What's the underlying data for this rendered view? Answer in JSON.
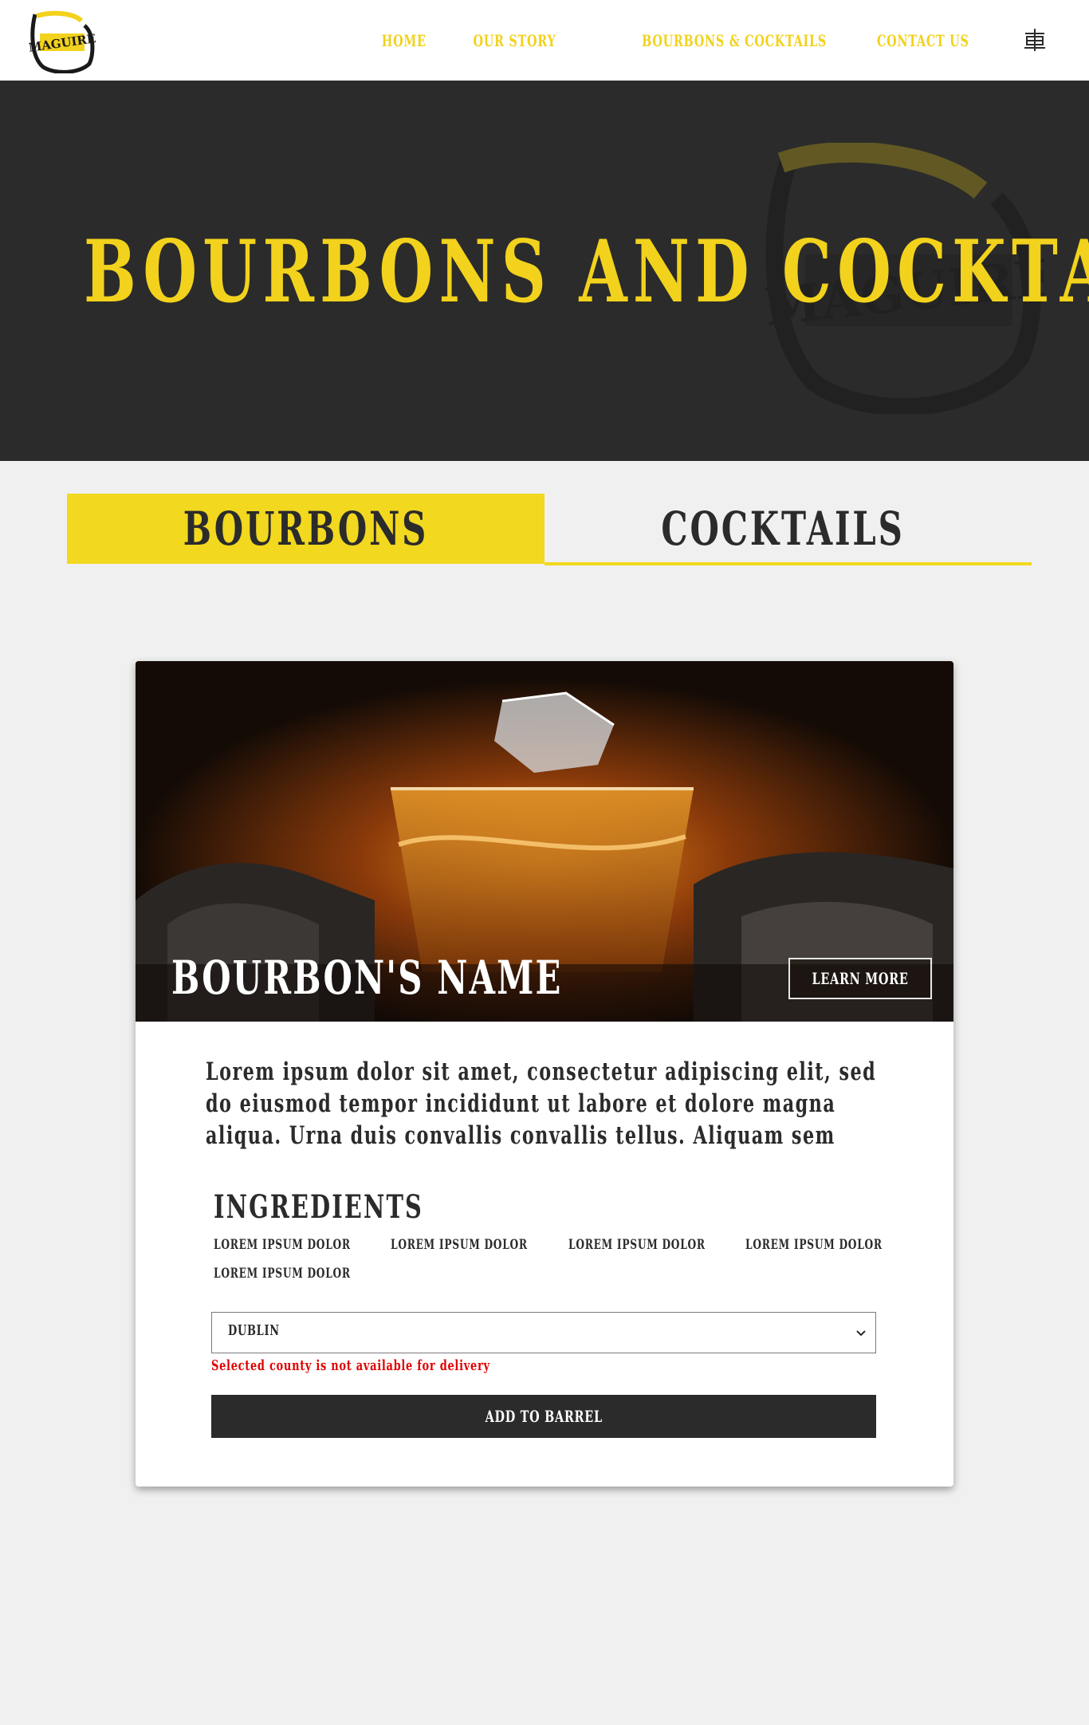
{
  "header": {
    "logo_text": "MAGUIRE",
    "nav": [
      {
        "label": "HOME"
      },
      {
        "label": "OUR STORY"
      },
      {
        "label": "BOURBONS & COCKTAILS"
      },
      {
        "label": "CONTACT US"
      }
    ],
    "language_icon": "translate-icon"
  },
  "hero": {
    "title": "BOURBONS AND COCKTAILS",
    "watermark_text": "MAGUIRE"
  },
  "tabs": [
    {
      "label": "BOURBONS",
      "active": true
    },
    {
      "label": "COCKTAILS",
      "active": false
    }
  ],
  "card": {
    "title": "BOURBON'S NAME",
    "learn_more": "LEARN MORE",
    "description": "Lorem ipsum dolor sit amet, consectetur adipiscing elit, sed do eiusmod tempor incididunt ut labore et dolore magna aliqua. Urna duis convallis convallis tellus. Aliquam sem",
    "ingredients_title": "INGREDIENTS",
    "ingredients": [
      "LOREM IPSUM DOLOR",
      "LOREM IPSUM DOLOR",
      "LOREM IPSUM DOLOR",
      "LOREM IPSUM DOLOR",
      "LOREM IPSUM DOLOR"
    ],
    "county_select": {
      "value": "DUBLIN"
    },
    "error": "Selected county is not available for delivery",
    "add_button": "ADD TO BARREL"
  },
  "colors": {
    "accent": "#f2d81f",
    "dark": "#2b2b2b",
    "background": "#f0f0f0",
    "error": "#e00000"
  }
}
